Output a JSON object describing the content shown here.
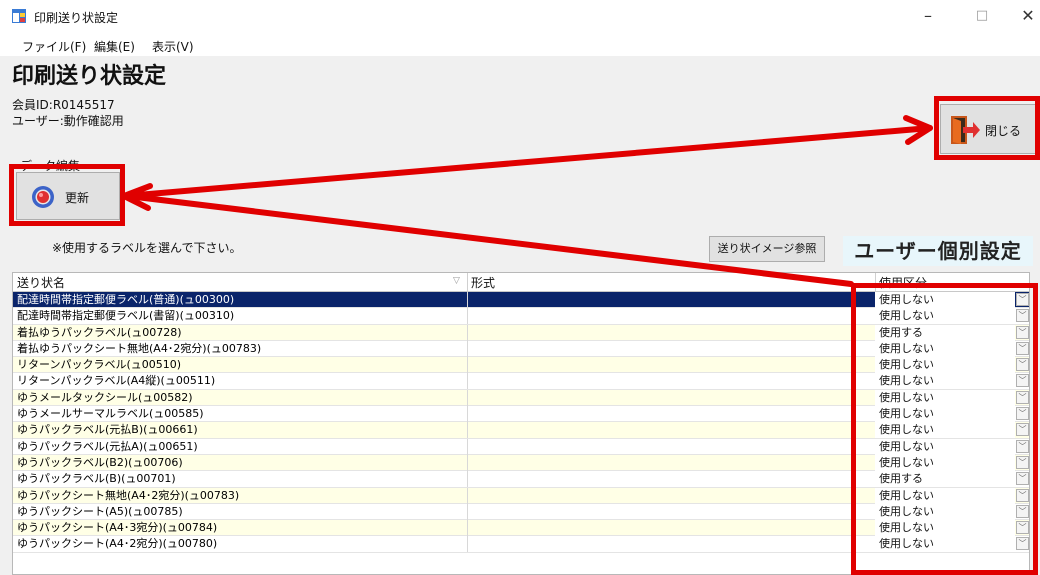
{
  "window": {
    "title": "印刷送り状設定",
    "minimize": "–",
    "maximize": "□",
    "close": "✕"
  },
  "menu": [
    "ファイル(F)",
    "編集(E)",
    "表示(V)"
  ],
  "page": {
    "title": "印刷送り状設定",
    "member_id": "会員ID:R0145517",
    "user": "ユーザー:動作確認用",
    "group_label": "データ編集"
  },
  "buttons": {
    "update": "更新",
    "close": "閉じる",
    "image_ref": "送り状イメージ参照"
  },
  "hint": "※使用するラベルを選んで下さい。",
  "callout": "ユーザー個別設定",
  "grid": {
    "columns": [
      "送り状名",
      "形式",
      "使用区分"
    ],
    "rows": [
      {
        "name": "配達時間帯指定郵便ラベル(普通)(ュ00300)",
        "usage": "使用しない"
      },
      {
        "name": "配達時間帯指定郵便ラベル(書留)(ュ00310)",
        "usage": "使用しない"
      },
      {
        "name": "着払ゆうパックラベル(ュ00728)",
        "usage": "使用する"
      },
      {
        "name": "着払ゆうパックシート無地(A4･2宛分)(ュ00783)",
        "usage": "使用しない"
      },
      {
        "name": "リターンパックラベル(ュ00510)",
        "usage": "使用しない"
      },
      {
        "name": "リターンパックラベル(A4縦)(ュ00511)",
        "usage": "使用しない"
      },
      {
        "name": "ゆうメールタックシール(ュ00582)",
        "usage": "使用しない"
      },
      {
        "name": "ゆうメールサーマルラベル(ュ00585)",
        "usage": "使用しない"
      },
      {
        "name": "ゆうパックラベル(元払B)(ュ00661)",
        "usage": "使用しない"
      },
      {
        "name": "ゆうパックラベル(元払A)(ュ00651)",
        "usage": "使用しない"
      },
      {
        "name": "ゆうパックラベル(B2)(ュ00706)",
        "usage": "使用しない"
      },
      {
        "name": "ゆうパックラベル(B)(ュ00701)",
        "usage": "使用する"
      },
      {
        "name": "ゆうパックシート無地(A4･2宛分)(ュ00783)",
        "usage": "使用しない"
      },
      {
        "name": "ゆうパックシート(A5)(ュ00785)",
        "usage": "使用しない"
      },
      {
        "name": "ゆうパックシート(A4･3宛分)(ュ00784)",
        "usage": "使用しない"
      },
      {
        "name": "ゆうパックシート(A4･2宛分)(ュ00780)",
        "usage": "使用しない"
      }
    ]
  },
  "colors": {
    "highlight": "#e00000",
    "selected_row": "#0a246a",
    "alt_row": "#ffffe6",
    "callout_bg": "#e8f6fb"
  },
  "icons": [
    "app-window-icon",
    "refresh-icon",
    "exit-door-icon",
    "dropdown-arrow-icon"
  ]
}
